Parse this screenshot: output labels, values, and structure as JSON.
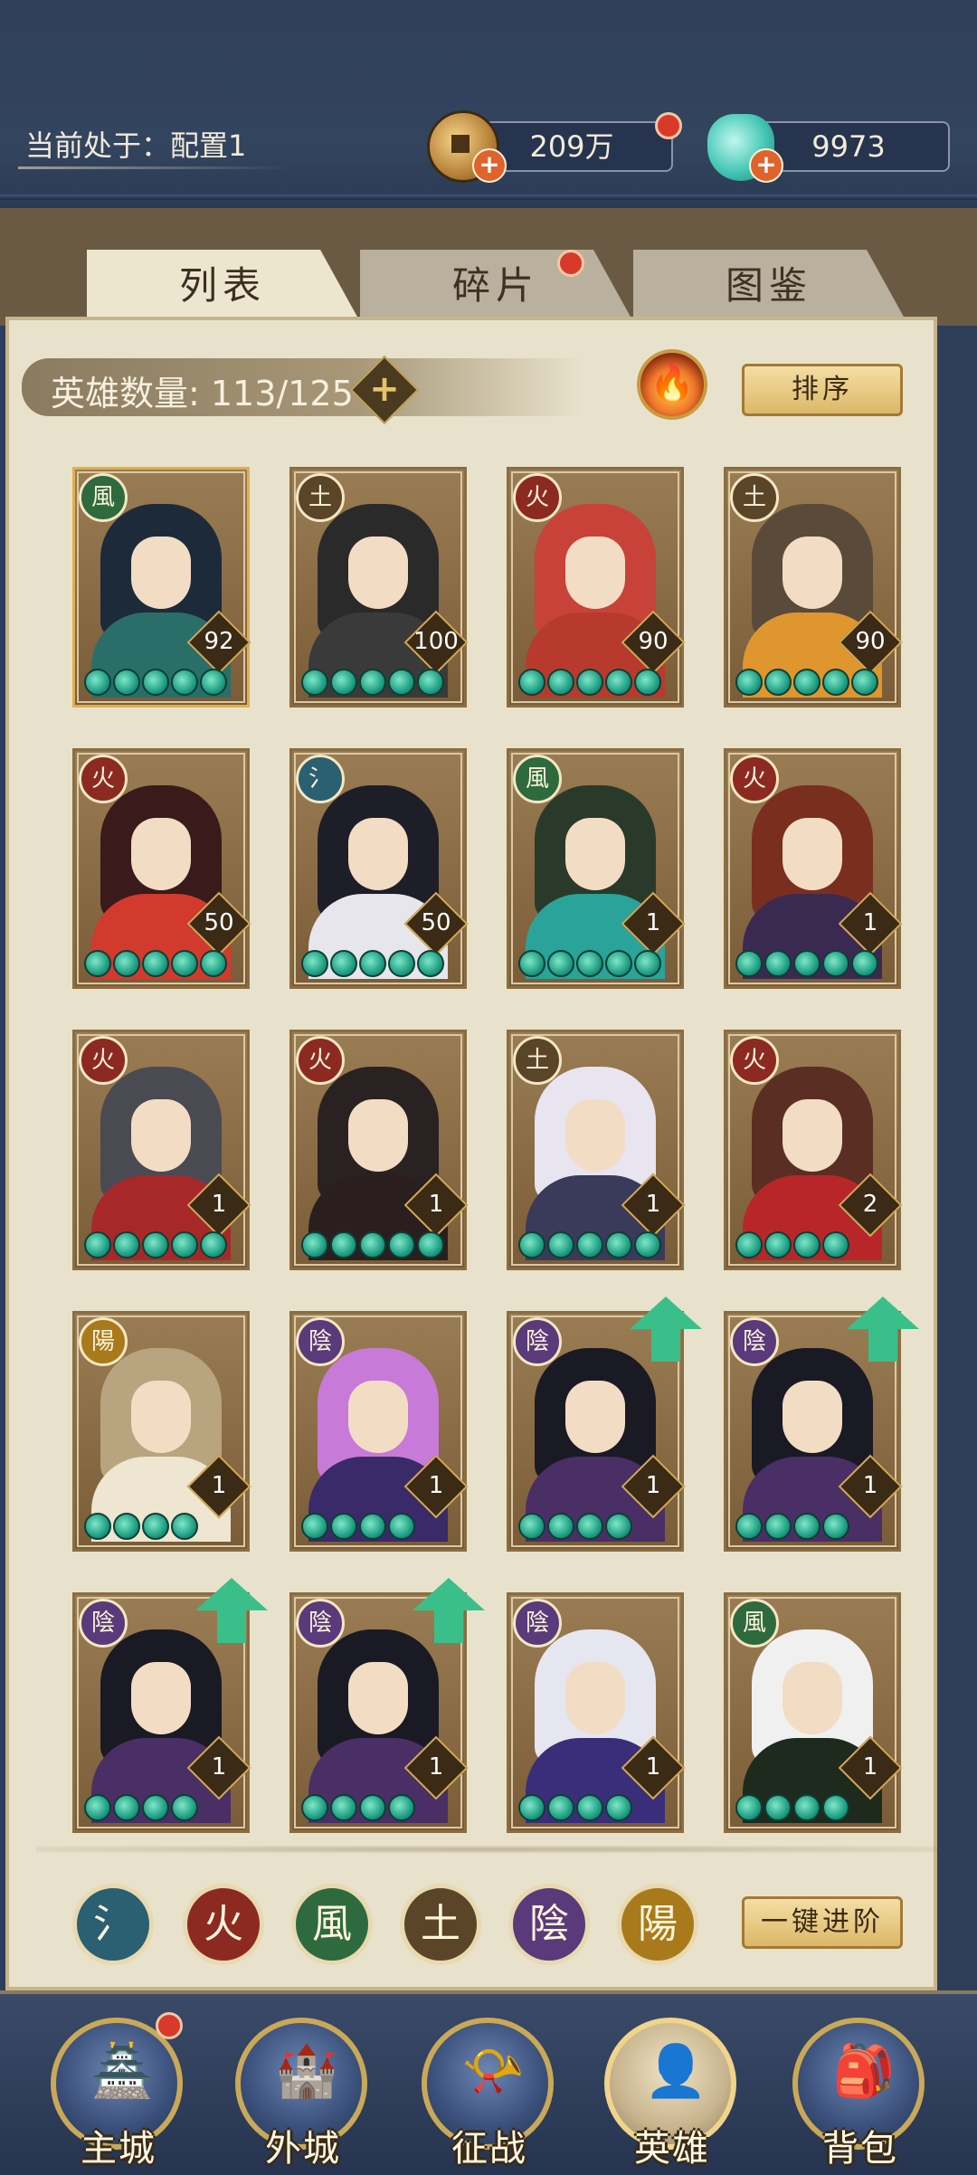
{
  "header": {
    "current_config": "当前处于：配置1",
    "gold_amount": "209万",
    "gem_amount": "9973"
  },
  "tabs": [
    {
      "label": "列表",
      "active": true
    },
    {
      "label": "碎片",
      "active": false,
      "has_notice": true
    },
    {
      "label": "图鉴",
      "active": false
    }
  ],
  "list": {
    "hero_count_label": "英雄数量: 113/125",
    "sort_label": "排序",
    "advance_label": "一键进阶"
  },
  "elements": {
    "water": "氵",
    "fire": "火",
    "wind": "風",
    "earth": "土",
    "yin": "陰",
    "yang": "陽"
  },
  "element_colors": {
    "water": "#2b5f72",
    "fire": "#8c2a22",
    "wind": "#2e6a3e",
    "earth": "#5a4528",
    "yin": "#5a3a7a",
    "yang": "#a87a1c"
  },
  "heroes": [
    {
      "element": "風",
      "level": "92",
      "stars": 5,
      "hair": "#1d2a3a",
      "body": "#2a6e6a",
      "upgrade": false,
      "gold_frame": true
    },
    {
      "element": "土",
      "level": "100",
      "stars": 5,
      "hair": "#2a2a2a",
      "body": "#3a3a3a",
      "upgrade": false,
      "gold_frame": false
    },
    {
      "element": "火",
      "level": "90",
      "stars": 5,
      "hair": "#c8423a",
      "body": "#b83a2e",
      "upgrade": false,
      "gold_frame": false
    },
    {
      "element": "土",
      "level": "90",
      "stars": 5,
      "hair": "#5a4a3a",
      "body": "#e0962e",
      "upgrade": false,
      "gold_frame": false
    },
    {
      "element": "火",
      "level": "50",
      "stars": 5,
      "hair": "#3a1a1a",
      "body": "#d23a2e",
      "upgrade": false,
      "gold_frame": false
    },
    {
      "element": "氵",
      "level": "50",
      "stars": 5,
      "hair": "#1e1e28",
      "body": "#e6e6ec",
      "upgrade": false,
      "gold_frame": false
    },
    {
      "element": "風",
      "level": "1",
      "stars": 5,
      "hair": "#2a3a2a",
      "body": "#2aa39a",
      "upgrade": false,
      "gold_frame": false
    },
    {
      "element": "火",
      "level": "1",
      "stars": 5,
      "hair": "#7a2e1e",
      "body": "#3a2a52",
      "upgrade": false,
      "gold_frame": false
    },
    {
      "element": "火",
      "level": "1",
      "stars": 5,
      "hair": "#4a4a52",
      "body": "#a8282a",
      "upgrade": false,
      "gold_frame": false
    },
    {
      "element": "火",
      "level": "1",
      "stars": 5,
      "hair": "#2a2222",
      "body": "#2a1e1e",
      "upgrade": false,
      "gold_frame": false
    },
    {
      "element": "土",
      "level": "1",
      "stars": 5,
      "hair": "#e8e4f0",
      "body": "#3a3a5a",
      "upgrade": false,
      "gold_frame": false
    },
    {
      "element": "火",
      "level": "2",
      "stars": 4,
      "hair": "#5a2e22",
      "body": "#b8262a",
      "upgrade": false,
      "gold_frame": false
    },
    {
      "element": "陽",
      "level": "1",
      "stars": 4,
      "hair": "#b8a47e",
      "body": "#eee6d0",
      "upgrade": false,
      "gold_frame": false
    },
    {
      "element": "陰",
      "level": "1",
      "stars": 4,
      "hair": "#c87ad8",
      "body": "#3a2a6a",
      "upgrade": false,
      "gold_frame": false
    },
    {
      "element": "陰",
      "level": "1",
      "stars": 4,
      "hair": "#1a1a24",
      "body": "#4a2e66",
      "upgrade": true,
      "gold_frame": false
    },
    {
      "element": "陰",
      "level": "1",
      "stars": 4,
      "hair": "#1a1a24",
      "body": "#4a2e66",
      "upgrade": true,
      "gold_frame": false
    },
    {
      "element": "陰",
      "level": "1",
      "stars": 4,
      "hair": "#1a1a24",
      "body": "#4a2e66",
      "upgrade": true,
      "gold_frame": false
    },
    {
      "element": "陰",
      "level": "1",
      "stars": 4,
      "hair": "#1a1a24",
      "body": "#4a2e66",
      "upgrade": true,
      "gold_frame": false
    },
    {
      "element": "陰",
      "level": "1",
      "stars": 4,
      "hair": "#e6e6f0",
      "body": "#3a2e7a",
      "upgrade": false,
      "gold_frame": false
    },
    {
      "element": "風",
      "level": "1",
      "stars": 4,
      "hair": "#f0f0f0",
      "body": "#1e2a1e",
      "upgrade": false,
      "gold_frame": false
    }
  ],
  "nav": [
    {
      "label": "主城",
      "glyph": "🏯",
      "has_notice": true,
      "active": false
    },
    {
      "label": "外城",
      "glyph": "🏰",
      "has_notice": false,
      "active": false
    },
    {
      "label": "征战",
      "glyph": "📯",
      "has_notice": false,
      "active": false
    },
    {
      "label": "英雄",
      "glyph": "👤",
      "has_notice": false,
      "active": true
    },
    {
      "label": "背包",
      "glyph": "🎒",
      "has_notice": false,
      "active": false
    }
  ],
  "icons": {
    "gold": "coin-icon",
    "gem": "gem-icon",
    "fire": "🔥",
    "plus": "+"
  }
}
